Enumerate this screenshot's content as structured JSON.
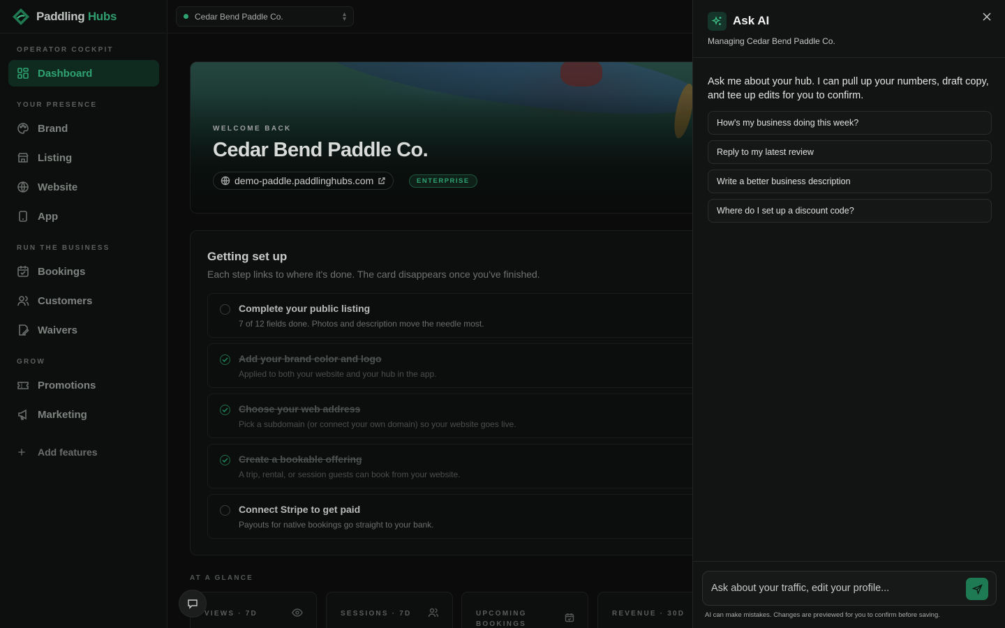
{
  "app": {
    "name_part1": "Paddling",
    "name_part2": "Hubs"
  },
  "org_switcher": {
    "label": "Cedar Bend Paddle Co."
  },
  "sidebar": {
    "sections": {
      "cockpit": "OPERATOR COCKPIT",
      "presence": "YOUR PRESENCE",
      "business": "RUN THE BUSINESS",
      "grow": "GROW"
    },
    "items": {
      "dashboard": "Dashboard",
      "brand": "Brand",
      "listing": "Listing",
      "website": "Website",
      "app": "App",
      "bookings": "Bookings",
      "customers": "Customers",
      "waivers": "Waivers",
      "promotions": "Promotions",
      "marketing": "Marketing",
      "add_features": "Add features"
    }
  },
  "hero": {
    "kicker": "WELCOME BACK",
    "title": "Cedar Bend Paddle Co.",
    "url": "demo-paddle.paddlinghubs.com",
    "plan_badge": "ENTERPRISE"
  },
  "setup": {
    "title": "Getting set up",
    "subtitle": "Each step links to where it's done. The card disappears once you've finished.",
    "steps": [
      {
        "title": "Complete your public listing",
        "desc": "7 of 12 fields done. Photos and description move the needle most.",
        "done": false
      },
      {
        "title": "Add your brand color and logo",
        "desc": "Applied to both your website and your hub in the app.",
        "done": true
      },
      {
        "title": "Choose your web address",
        "desc": "Pick a subdomain (or connect your own domain) so your website goes live.",
        "done": true
      },
      {
        "title": "Create a bookable offering",
        "desc": "A trip, rental, or session guests can book from your website.",
        "done": true
      },
      {
        "title": "Connect Stripe to get paid",
        "desc": "Payouts for native bookings go straight to your bank.",
        "done": false
      }
    ]
  },
  "glance": {
    "label": "AT A GLANCE",
    "stats": [
      "VIEWS · 7D",
      "SESSIONS · 7D",
      "UPCOMING BOOKINGS",
      "REVENUE · 30D"
    ]
  },
  "ai": {
    "title": "Ask AI",
    "subtitle": "Managing Cedar Bend Paddle Co.",
    "intro": "Ask me about your hub. I can pull up your numbers, draft copy, and tee up edits for you to confirm.",
    "suggestions": [
      "How's my business doing this week?",
      "Reply to my latest review",
      "Write a better business description",
      "Where do I set up a discount code?"
    ],
    "input_placeholder": "Ask about your traffic, edit your profile...",
    "disclaimer": "AI can make mistakes. Changes are previewed for you to confirm before saving."
  },
  "colors": {
    "accent": "#2fa472",
    "panel_bg": "#121413",
    "page_bg": "#0a0b0a"
  }
}
